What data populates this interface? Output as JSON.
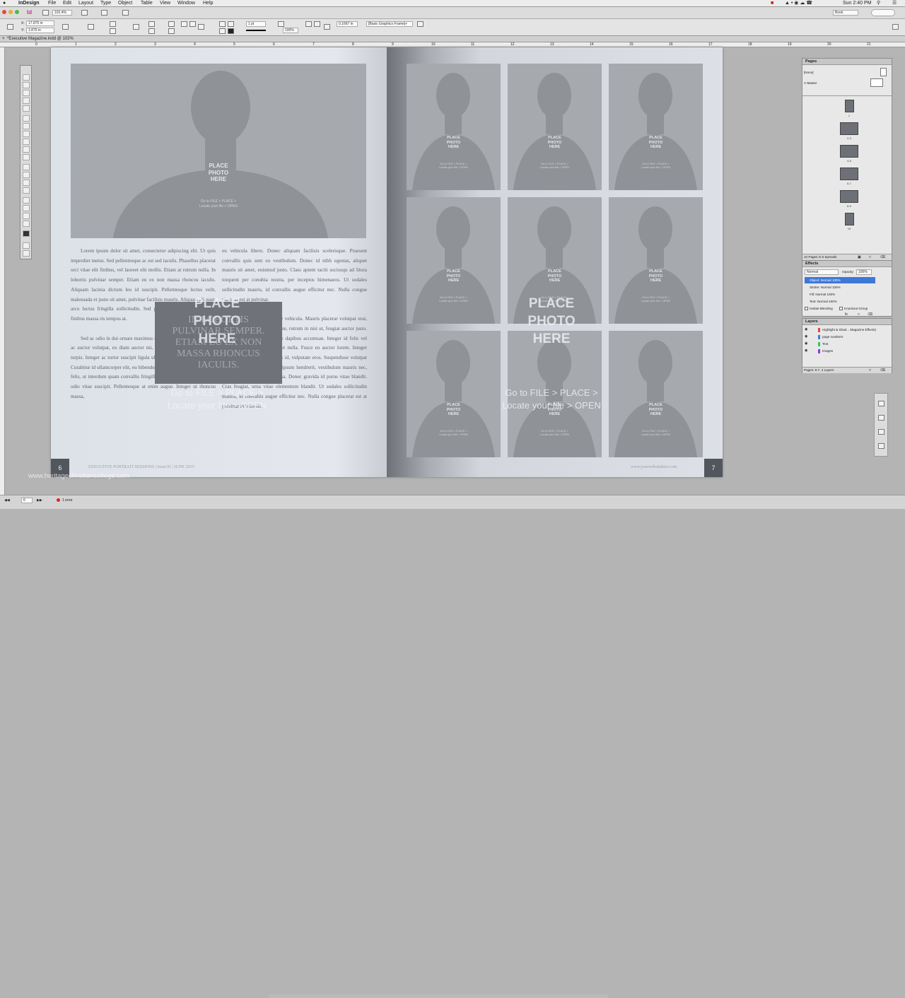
{
  "menubar": {
    "app": "InDesign",
    "items": [
      "File",
      "Edit",
      "Layout",
      "Type",
      "Object",
      "Table",
      "View",
      "Window",
      "Help"
    ],
    "time": "Sun 2:40 PM",
    "workspace": "Book"
  },
  "control": {
    "app_badge": "Id",
    "zoom": "102.4%",
    "x": "17.875 in",
    "y": "1.875 in",
    "stroke": "1 pt",
    "pct": "100%",
    "offset": "0.1667 in",
    "style": "[Basic Graphics Frame]+"
  },
  "doc_tab": "*Executive Magazine.indd @ 102%",
  "ruler_ticks": [
    "0",
    "1",
    "2",
    "3",
    "4",
    "5",
    "6",
    "7",
    "8",
    "9",
    "10",
    "11",
    "12",
    "13",
    "14",
    "15",
    "16",
    "17",
    "18",
    "19",
    "20",
    "21"
  ],
  "left_page": {
    "photo": {
      "title_lines": [
        "PLACE",
        "PHOTO",
        "HERE"
      ],
      "sub_lines": [
        "Go to FILE > PLACE >",
        "Locate your file > OPEN"
      ]
    },
    "col1": [
      "Lorem ipsum dolor sit amet, consectetur adipiscing elit. Ut quis imperdiet metus. Sed pellentesque ac est sed iaculis. Phasellus placerat orci vitae elit finibus, vel laoreet elit mollis. Etiam at rutrum nulla. In lobortis pulvinar semper. Etiam eu ex non massa rhoncus iaculis. Aliquam lacinia dictum leo id suscipit. Pellentesque lectus velit, malesuada et justo sit amet, pulvinar facilisis mauris. Aliquam aliquam arcu luctus fringilla sollicitudin. Sed pulvinar finibus quam, vitae finibus massa ris tempus at.",
      "Sed ac odio in dui ornare maximus non et odio. Nam egestas, dui ac auctor volutpat, ex diam auctor mi, porta cursus quam odio eget turpis. Integer ac tortor suscipit ligula ullamcorper imperdiet eget mi. Curabitur id ullamcorper elit, eu bibendum nulla. Donec tincidunt ante felis, ut interdum quam convallis fringilla. Maecenas tincidunt rutrum odio vitae suscipit. Pellentesque at enim augue. Integer ut rhoncus massa,"
    ],
    "col2": [
      "eu vehicula libero. Donec aliquam facilisis scelerisque. Praesent convallis quis sem eu vestibulum. Donec id nibh egestas, aliquet mauris sit amet, euismod justo. Class aptent taciti sociosqu ad litora torquent per conubia nostra, per inceptos himenaeos. Ut sodales sollicitudin mauris, id convallis augue efficitur nec. Nulla congue placerat est at pulvinar.",
      "Proin commodo posuere vehicula. Mauris placerat volutpat erat, non cursus leo. Nam nunc ante, rutrum in nisi ut, feugiat auctor justo. Fusce blandit purus molestie dapibus accumsan. Integer id felis vel augue molestie semper vel et nulla. Fusce eu auctor lorem. Integer vitae sem lacinia, mollis eros id, vulputate eros. Suspendisse volutpat vel erat a tincidunt. Sed ac ipsum hendrerit, vestibulum mauris nec, porta ante. Duis et orci massa. Donec gravida id purus vitae blandit. Cras feugiat, urna vitae elementum blandit. Ut sodales sollicitudin mauris, id convallis augue efficitur nec. Nulla congue placerat est at pulvinar in lobortis."
    ],
    "pull_quote_lines": [
      "IN LOBORTIS",
      "PULVINAR SEMPER.",
      "ETIAM EU EX NON",
      "MASSA RHONCUS",
      "IACULIS."
    ],
    "page_number": "6",
    "footer": "EXECUTIVE PORTRAIT SESSIONS  |  Issue 01  |  JUNE 2015"
  },
  "overlay": {
    "title_lines": [
      "PLACE",
      "PHOTO",
      "HERE"
    ],
    "sub_lines": [
      "Go to FILE > PLACE >",
      "Locate your file > OPEN"
    ]
  },
  "right_page": {
    "grid_photo": {
      "title_lines": [
        "PLACE",
        "PHOTO",
        "HERE"
      ],
      "sub_lines": [
        "Go to FILE > PLACE >",
        "Locate your file > OPEN"
      ]
    },
    "page_number": "7",
    "footer": "www.yourwebsitehere.com"
  },
  "pages_panel": {
    "title": "Pages",
    "none": "[None]",
    "master": "A-Master",
    "thumbs": [
      "1",
      "2-3",
      "4-5",
      "6-7",
      "8-9",
      "10"
    ],
    "footer": "10 Pages in 6 Spreads"
  },
  "effects_panel": {
    "title": "Effects",
    "mode": "Normal",
    "opacity_label": "Opacity:",
    "opacity": "100%",
    "rows": [
      "Object: Normal 100%",
      "Stroke: Normal 100%",
      "Fill: Normal 100%",
      "Text: Normal 100%"
    ],
    "isolate": "Isolate Blending",
    "knockout": "Knockout Group"
  },
  "layers_panel": {
    "title": "Layers",
    "layers": [
      "Highlight & Shad... Magazine Effects)",
      "page numbers",
      "Text",
      "Images"
    ],
    "footer": "Pages: 6-7, 4 Layers"
  },
  "status": {
    "page": "6",
    "errors": "1 error"
  },
  "watermark": "www.heritagechristiancollege.com"
}
